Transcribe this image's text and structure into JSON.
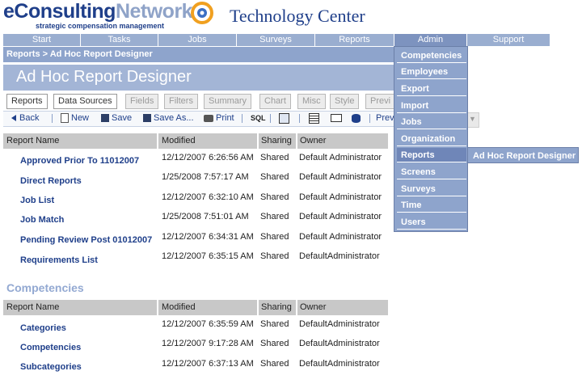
{
  "header": {
    "logo_part1": "eConsulting",
    "logo_part2": "Network",
    "tagline": "strategic compensation management",
    "app_title": "Technology Center"
  },
  "nav": [
    "Start",
    "Tasks",
    "Jobs",
    "Surveys",
    "Reports",
    "Admin",
    "Support"
  ],
  "breadcrumb": "Reports > Ad Hoc Report Designer",
  "page_title": "Ad Hoc Report Designer",
  "tabs": [
    "Reports",
    "Data Sources",
    "Fields",
    "Filters",
    "Summary",
    "Chart",
    "Misc",
    "Style",
    "Previ"
  ],
  "toolbar": {
    "back": "Back",
    "new": "New",
    "save": "Save",
    "save_as": "Save As...",
    "print": "Print",
    "sql": "SQL",
    "preview": "Previ"
  },
  "table_headers": [
    "Report Name",
    "Modified",
    "Sharing",
    "Owner"
  ],
  "reports": [
    {
      "name": "Approved Prior To 11012007",
      "modified": "12/12/2007 6:26:56 AM",
      "sharing": "Shared",
      "owner": "Default Administrator"
    },
    {
      "name": "Direct Reports",
      "modified": "1/25/2008 7:57:17 AM",
      "sharing": "Shared",
      "owner": "Default Administrator"
    },
    {
      "name": "Job List",
      "modified": "12/12/2007 6:32:10 AM",
      "sharing": "Shared",
      "owner": "Default Administrator"
    },
    {
      "name": "Job Match",
      "modified": "1/25/2008 7:51:01 AM",
      "sharing": "Shared",
      "owner": "Default Administrator"
    },
    {
      "name": "Pending Review Post 01012007",
      "modified": "12/12/2007 6:34:31 AM",
      "sharing": "Shared",
      "owner": "Default Administrator"
    },
    {
      "name": "Requirements List",
      "modified": "12/12/2007 6:35:15 AM",
      "sharing": "Shared",
      "owner": "DefaultAdministrator"
    }
  ],
  "competencies_heading": "Competencies",
  "competencies": [
    {
      "name": "Categories",
      "modified": "12/12/2007 6:35:59 AM",
      "sharing": "Shared",
      "owner": "DefaultAdministrator"
    },
    {
      "name": "Competencies",
      "modified": "12/12/2007 9:17:28 AM",
      "sharing": "Shared",
      "owner": "DefaultAdministrator"
    },
    {
      "name": "Subcategories",
      "modified": "12/12/2007 6:37:13 AM",
      "sharing": "Shared",
      "owner": "DefaultAdministrator"
    }
  ],
  "admin_menu": [
    "Competencies",
    "Employees",
    "Export",
    "Import",
    "Jobs",
    "Organization",
    "Reports",
    "Screens",
    "Surveys",
    "Time",
    "Users"
  ],
  "submenu": "Ad Hoc Report Designer",
  "colors": {
    "brand": "#1f3f8a",
    "nav": "#9aaed0",
    "menu": "#8ea4cc",
    "heading": "#93a9d2"
  }
}
